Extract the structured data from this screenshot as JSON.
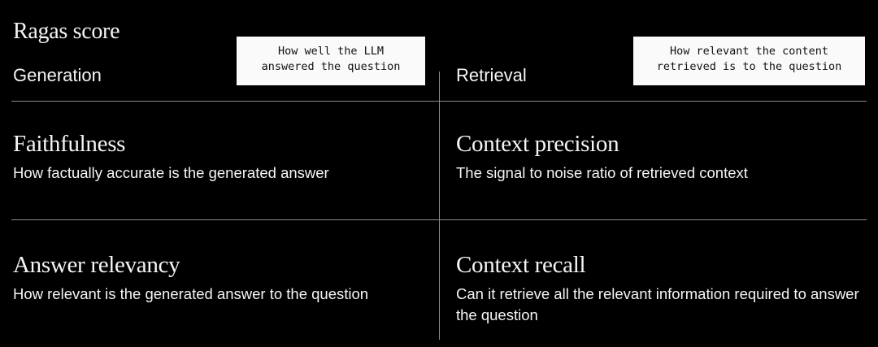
{
  "title": "Ragas score",
  "generation": {
    "heading": "Generation",
    "callout": "How well the LLM\nanswered the question",
    "metrics": [
      {
        "name": "Faithfulness",
        "description": "How factually accurate is the generated answer"
      },
      {
        "name": "Answer relevancy",
        "description": "How relevant is the generated answer to the question"
      }
    ]
  },
  "retrieval": {
    "heading": "Retrieval",
    "callout": "How relevant the content\nretrieved is to the question",
    "metrics": [
      {
        "name": "Context precision",
        "description": "The signal to noise ratio of retrieved context"
      },
      {
        "name": "Context recall",
        "description": "Can it retrieve all the relevant information required to answer the question"
      }
    ]
  }
}
